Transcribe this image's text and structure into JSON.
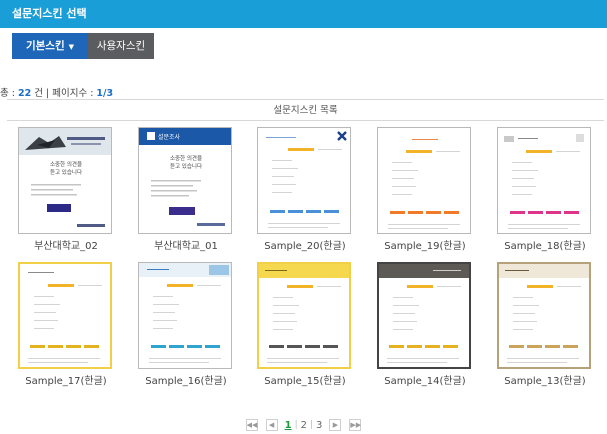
{
  "titlebar": {
    "title": "설문지스킨 선택"
  },
  "tabs": {
    "basic": "기본스킨",
    "user": "사용자스킨"
  },
  "summary": {
    "total_prefix": "총 : ",
    "total": "22",
    "total_suffix": " 건 | 페이지수 : ",
    "page": "1/3"
  },
  "list_title": "설문지스킨 목록",
  "skins": [
    {
      "name": "부산대학교_02"
    },
    {
      "name": "부산대학교_01"
    },
    {
      "name": "Sample_20(한글)"
    },
    {
      "name": "Sample_19(한글)"
    },
    {
      "name": "Sample_18(한글)"
    },
    {
      "name": "Sample_17(한글)"
    },
    {
      "name": "Sample_16(한글)"
    },
    {
      "name": "Sample_15(한글)"
    },
    {
      "name": "Sample_14(한글)"
    },
    {
      "name": "Sample_13(한글)"
    }
  ],
  "thumb_texts": {
    "pnu01_header": "설문조사",
    "pnu_line1": "소중한 의견을",
    "pnu_line2": "듣고 있습니다"
  },
  "pager": {
    "first": "◀◀",
    "prev": "◀",
    "pages": [
      "1",
      "2",
      "3"
    ],
    "active": "1",
    "next": "▶",
    "last": "▶▶"
  },
  "colors": {
    "titlebar": "#1a9ed8",
    "tab_active": "#1e67b8",
    "tab_inactive": "#5a5c5f",
    "count_accent": "#1c6ec7",
    "pager_active": "#1e9a3c"
  }
}
